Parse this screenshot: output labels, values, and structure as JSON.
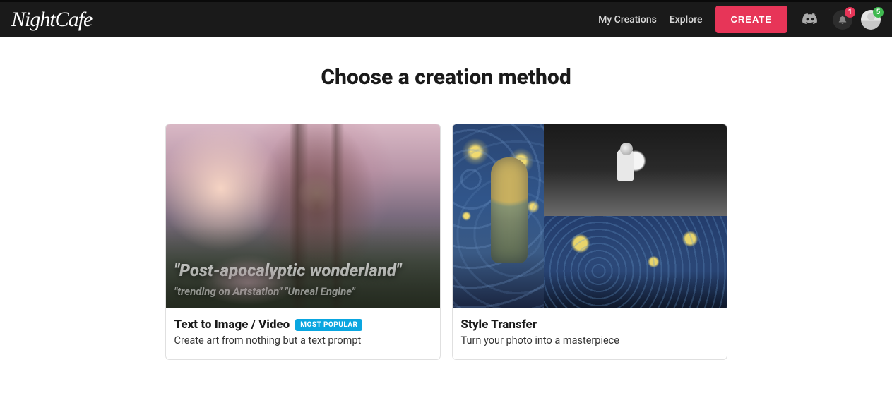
{
  "brand": "NightCafe",
  "nav": {
    "my_creations": "My Creations",
    "explore": "Explore",
    "create": "CREATE"
  },
  "notifications": {
    "count": "1"
  },
  "credits": {
    "count": "5"
  },
  "page": {
    "title": "Choose a creation method"
  },
  "cards": {
    "t2i": {
      "title": "Text to Image / Video",
      "badge": "MOST POPULAR",
      "desc": "Create art from nothing but a text prompt",
      "overlay_main": "\"Post-apocalyptic wonderland\"",
      "overlay_sub": "\"trending on Artstation\" \"Unreal Engine\""
    },
    "style": {
      "title": "Style Transfer",
      "desc": "Turn your photo into a masterpiece"
    }
  }
}
